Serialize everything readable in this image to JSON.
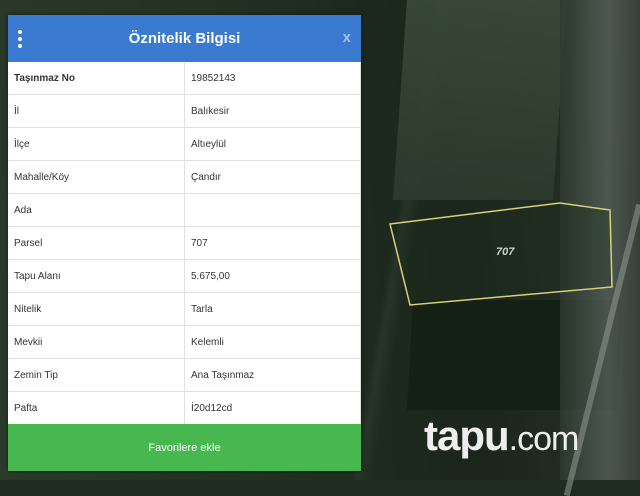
{
  "panel": {
    "title": "Öznitelik Bilgisi",
    "close": "x",
    "rows": [
      {
        "key": "Taşınmaz No",
        "value": "19852143"
      },
      {
        "key": "İl",
        "value": "Balıkesir"
      },
      {
        "key": "İlçe",
        "value": "Altıeylül"
      },
      {
        "key": "Mahalle/Köy",
        "value": "Çandır"
      },
      {
        "key": "Ada",
        "value": ""
      },
      {
        "key": "Parsel",
        "value": "707"
      },
      {
        "key": "Tapu Alanı",
        "value": "5.675,00"
      },
      {
        "key": "Nitelik",
        "value": "Tarla"
      },
      {
        "key": "Mevkii",
        "value": "Kelemli"
      },
      {
        "key": "Zemin Tip",
        "value": "Ana Taşınmaz"
      },
      {
        "key": "Pafta",
        "value": "İ20d12cd"
      }
    ],
    "favorite_button": "Favorilere ekle"
  },
  "map": {
    "parcel_label": "707",
    "parcel_outline_color": "#d6d27a"
  },
  "brand": {
    "name": "tapu",
    "suffix": ".com"
  }
}
